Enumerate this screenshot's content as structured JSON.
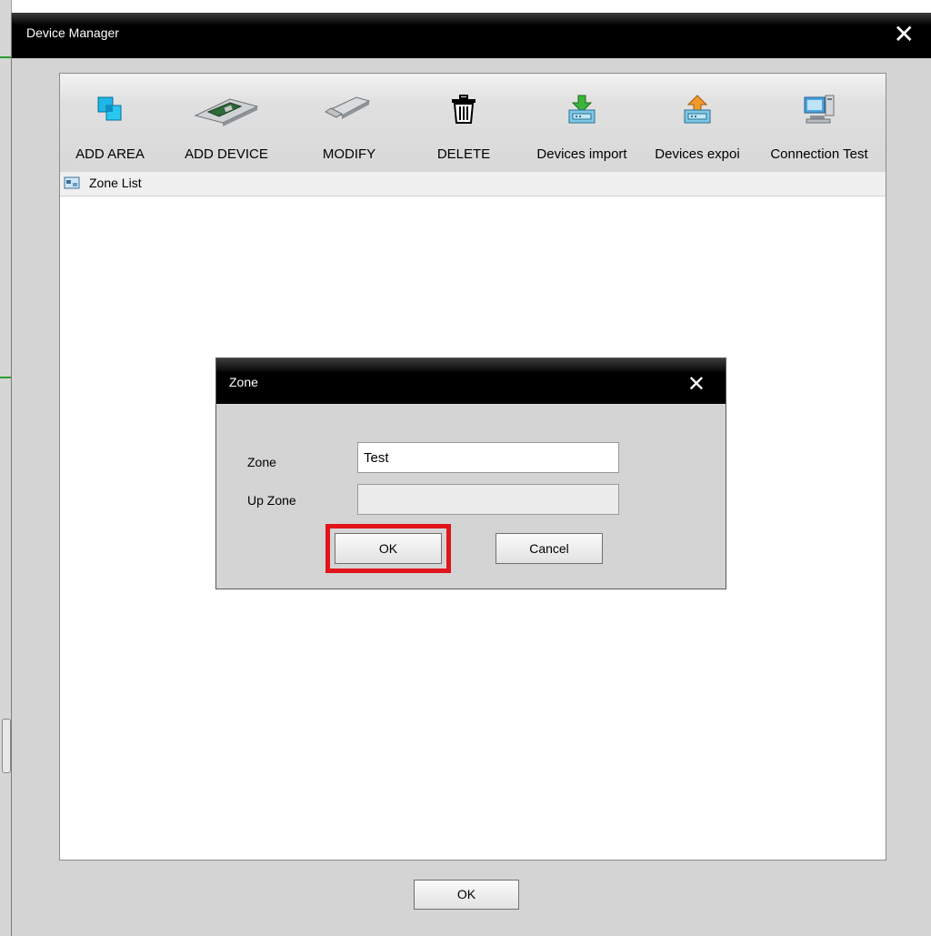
{
  "window": {
    "title": "Device Manager",
    "close_glyph": "✕"
  },
  "toolbar": {
    "items": [
      {
        "label": "ADD AREA",
        "icon": "add-area-icon"
      },
      {
        "label": "ADD DEVICE",
        "icon": "add-device-icon"
      },
      {
        "label": "MODIFY",
        "icon": "modify-icon"
      },
      {
        "label": "DELETE",
        "icon": "trash-icon"
      },
      {
        "label": "Devices import",
        "icon": "import-icon"
      },
      {
        "label": "Devices expoi",
        "icon": "export-icon"
      },
      {
        "label": "Connection Test",
        "icon": "connection-test-icon"
      }
    ]
  },
  "tree": {
    "header_label": "Zone List",
    "icon": "zone-list-icon"
  },
  "footer": {
    "ok_label": "OK"
  },
  "zone_dialog": {
    "title": "Zone",
    "close_glyph": "✕",
    "zone_label": "Zone",
    "zone_value": "Test",
    "up_zone_label": "Up Zone",
    "up_zone_value": "",
    "ok_label": "OK",
    "cancel_label": "Cancel",
    "highlight_color": "#e0141b"
  },
  "colors": {
    "titlebar": "#000000",
    "dialog_bg": "#d4d4d4",
    "highlight": "#e0141b"
  }
}
